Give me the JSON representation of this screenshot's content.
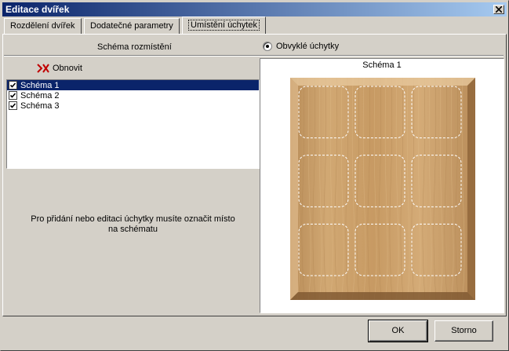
{
  "window": {
    "title": "Editace dvířek",
    "close_icon": "close-icon"
  },
  "tabs": [
    {
      "label": "Rozdělení dvířek"
    },
    {
      "label": "Dodatečné parametry"
    },
    {
      "label": "Umístění úchytek"
    }
  ],
  "active_tab": 2,
  "schema_section": {
    "label": "Schéma rozmístění"
  },
  "handle_type": {
    "label": "Obvyklé úchytky",
    "selected": true
  },
  "toolbar": {
    "refresh_label": "Obnovit",
    "refresh_icon": "refresh-icon"
  },
  "schemas": [
    {
      "label": "Schéma 1",
      "checked": true,
      "selected": true
    },
    {
      "label": "Schéma 2",
      "checked": true,
      "selected": false
    },
    {
      "label": "Schéma 3",
      "checked": true,
      "selected": false
    }
  ],
  "hint": {
    "line1": "Pro přidání nebo editaci úchytky musíte označit místo",
    "line2": "na schématu"
  },
  "preview": {
    "title": "Schéma 1",
    "slot_rows": 3,
    "slot_cols": 3
  },
  "buttons": {
    "ok": "OK",
    "cancel": "Storno"
  },
  "colors": {
    "title_start": "#0a246a",
    "title_end": "#a6caf0",
    "selection": "#0a246a",
    "wood": "#c9a06d"
  }
}
